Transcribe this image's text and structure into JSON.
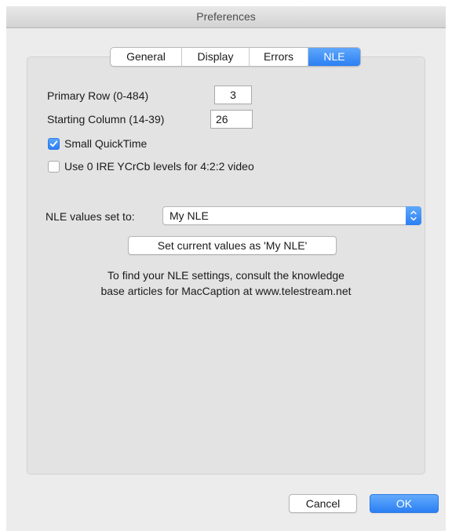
{
  "window": {
    "title": "Preferences"
  },
  "tabs": [
    {
      "label": "General",
      "active": false
    },
    {
      "label": "Display",
      "active": false
    },
    {
      "label": "Errors",
      "active": false
    },
    {
      "label": "NLE",
      "active": true
    }
  ],
  "nle": {
    "primary_row_label": "Primary Row (0-484)",
    "primary_row_value": "3",
    "starting_column_label": "Starting Column (14-39)",
    "starting_column_value": "26",
    "small_quicktime": {
      "label": "Small QuickTime",
      "checked": true
    },
    "ire_levels": {
      "label": "Use 0 IRE YCrCb levels for 4:2:2 video",
      "checked": false
    },
    "values_set_label": "NLE values set to:",
    "values_set_selected": "My NLE",
    "set_current_button": "Set current values as 'My NLE'",
    "info_line1": "To find your NLE settings, consult the knowledge",
    "info_line2": "base articles for MacCaption at www.telestream.net"
  },
  "footer": {
    "cancel_label": "Cancel",
    "ok_label": "OK"
  },
  "colors": {
    "accent": "#2b7ff4"
  }
}
